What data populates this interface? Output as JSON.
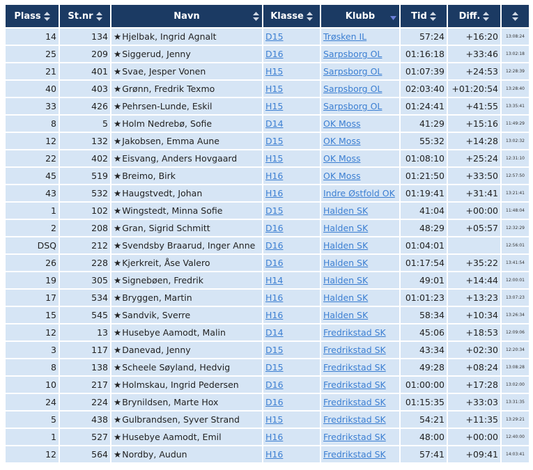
{
  "headers": {
    "plass": "Plass",
    "stnr": "St.nr",
    "navn": "Navn",
    "klasse": "Klasse",
    "klubb": "Klubb",
    "tid": "Tid",
    "diff": "Diff."
  },
  "colors": {
    "header_bg": "#1b3a63",
    "row_bg": "#d6e5f5",
    "link": "#3c7fd2"
  },
  "rows": [
    {
      "plass": "14",
      "stnr": "134",
      "navn": "Hjelbak, Ingrid Agnalt",
      "klasse": "D15",
      "klubb": "Trøsken IL",
      "tid": "57:24",
      "diff": "+16:20",
      "ts": "13:08:24"
    },
    {
      "plass": "25",
      "stnr": "209",
      "navn": "Siggerud, Jenny",
      "klasse": "D16",
      "klubb": "Sarpsborg OL",
      "tid": "01:16:18",
      "diff": "+33:46",
      "ts": "13:02:18"
    },
    {
      "plass": "21",
      "stnr": "401",
      "navn": "Svae, Jesper Vonen",
      "klasse": "H15",
      "klubb": "Sarpsborg OL",
      "tid": "01:07:39",
      "diff": "+24:53",
      "ts": "12:28:39"
    },
    {
      "plass": "40",
      "stnr": "403",
      "navn": "Grønn, Fredrik Texmo",
      "klasse": "H15",
      "klubb": "Sarpsborg OL",
      "tid": "02:03:40",
      "diff": "+01:20:54",
      "ts": "13:28:40"
    },
    {
      "plass": "33",
      "stnr": "426",
      "navn": "Pehrsen-Lunde, Eskil",
      "klasse": "H15",
      "klubb": "Sarpsborg OL",
      "tid": "01:24:41",
      "diff": "+41:55",
      "ts": "13:35:41"
    },
    {
      "plass": "8",
      "stnr": "5",
      "navn": "Holm Nedrebø, Sofie",
      "klasse": "D14",
      "klubb": "OK Moss",
      "tid": "41:29",
      "diff": "+15:16",
      "ts": "11:49:29"
    },
    {
      "plass": "12",
      "stnr": "132",
      "navn": "Jakobsen, Emma Aune",
      "klasse": "D15",
      "klubb": "OK Moss",
      "tid": "55:32",
      "diff": "+14:28",
      "ts": "13:02:32"
    },
    {
      "plass": "22",
      "stnr": "402",
      "navn": "Eisvang, Anders Hovgaard",
      "klasse": "H15",
      "klubb": "OK Moss",
      "tid": "01:08:10",
      "diff": "+25:24",
      "ts": "12:31:10"
    },
    {
      "plass": "45",
      "stnr": "519",
      "navn": "Breimo, Birk",
      "klasse": "H16",
      "klubb": "OK Moss",
      "tid": "01:21:50",
      "diff": "+33:50",
      "ts": "12:57:50"
    },
    {
      "plass": "43",
      "stnr": "532",
      "navn": "Haugstvedt, Johan",
      "klasse": "H16",
      "klubb": "Indre Østfold OK",
      "tid": "01:19:41",
      "diff": "+31:41",
      "ts": "13:21:41"
    },
    {
      "plass": "1",
      "stnr": "102",
      "navn": "Wingstedt, Minna Sofie",
      "klasse": "D15",
      "klubb": "Halden SK",
      "tid": "41:04",
      "diff": "+00:00",
      "ts": "11:48:04"
    },
    {
      "plass": "2",
      "stnr": "208",
      "navn": "Gran, Sigrid Schmitt",
      "klasse": "D16",
      "klubb": "Halden SK",
      "tid": "48:29",
      "diff": "+05:57",
      "ts": "12:32:29"
    },
    {
      "plass": "DSQ",
      "stnr": "212",
      "navn": "Svendsby Braarud, Inger Anne",
      "klasse": "D16",
      "klubb": "Halden SK",
      "tid": "01:04:01",
      "diff": "",
      "ts": "12:56:01"
    },
    {
      "plass": "26",
      "stnr": "228",
      "navn": "Kjerkreit, Åse Valero",
      "klasse": "D16",
      "klubb": "Halden SK",
      "tid": "01:17:54",
      "diff": "+35:22",
      "ts": "13:41:54"
    },
    {
      "plass": "19",
      "stnr": "305",
      "navn": "Signebøen, Fredrik",
      "klasse": "H14",
      "klubb": "Halden SK",
      "tid": "49:01",
      "diff": "+14:44",
      "ts": "12:00:01"
    },
    {
      "plass": "17",
      "stnr": "534",
      "navn": "Bryggen, Martin",
      "klasse": "H16",
      "klubb": "Halden SK",
      "tid": "01:01:23",
      "diff": "+13:23",
      "ts": "13:07:23"
    },
    {
      "plass": "15",
      "stnr": "545",
      "navn": "Sandvik, Sverre",
      "klasse": "H16",
      "klubb": "Halden SK",
      "tid": "58:34",
      "diff": "+10:34",
      "ts": "13:26:34"
    },
    {
      "plass": "12",
      "stnr": "13",
      "navn": "Husebye Aamodt, Malin",
      "klasse": "D14",
      "klubb": "Fredrikstad SK",
      "tid": "45:06",
      "diff": "+18:53",
      "ts": "12:09:06"
    },
    {
      "plass": "3",
      "stnr": "117",
      "navn": "Danevad, Jenny",
      "klasse": "D15",
      "klubb": "Fredrikstad SK",
      "tid": "43:34",
      "diff": "+02:30",
      "ts": "12:20:34"
    },
    {
      "plass": "8",
      "stnr": "138",
      "navn": "Scheele Søyland, Hedvig",
      "klasse": "D15",
      "klubb": "Fredrikstad SK",
      "tid": "49:28",
      "diff": "+08:24",
      "ts": "13:08:28"
    },
    {
      "plass": "10",
      "stnr": "217",
      "navn": "Holmskau, Ingrid Pedersen",
      "klasse": "D16",
      "klubb": "Fredrikstad SK",
      "tid": "01:00:00",
      "diff": "+17:28",
      "ts": "13:02:00"
    },
    {
      "plass": "24",
      "stnr": "224",
      "navn": "Brynildsen, Marte Hox",
      "klasse": "D16",
      "klubb": "Fredrikstad SK",
      "tid": "01:15:35",
      "diff": "+33:03",
      "ts": "13:31:35"
    },
    {
      "plass": "5",
      "stnr": "438",
      "navn": "Gulbrandsen, Syver Strand",
      "klasse": "H15",
      "klubb": "Fredrikstad SK",
      "tid": "54:21",
      "diff": "+11:35",
      "ts": "13:29:21"
    },
    {
      "plass": "1",
      "stnr": "527",
      "navn": "Husebye Aamodt, Emil",
      "klasse": "H16",
      "klubb": "Fredrikstad SK",
      "tid": "48:00",
      "diff": "+00:00",
      "ts": "12:40:00"
    },
    {
      "plass": "12",
      "stnr": "564",
      "navn": "Nordby, Audun",
      "klasse": "H16",
      "klubb": "Fredrikstad SK",
      "tid": "57:41",
      "diff": "+09:41",
      "ts": "14:03:41"
    }
  ]
}
